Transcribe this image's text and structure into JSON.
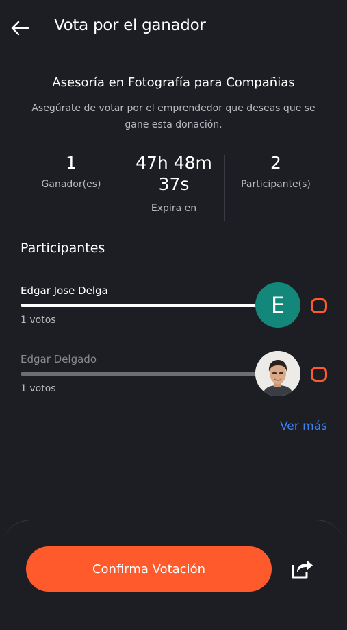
{
  "header": {
    "title": "Vota por el ganador",
    "back_icon": "arrow-left-icon"
  },
  "intro": {
    "heading": "Asesoría en Fotografía para Compañias",
    "description": "Asegúrate de votar por el emprendedor que deseas que se gane esta donación."
  },
  "stats": {
    "winners": {
      "value": "1",
      "label": "Ganador(es)"
    },
    "timer": {
      "value_line1": "47h 48m",
      "value_line2": "37s",
      "label": "Expira en"
    },
    "participants": {
      "value": "2",
      "label": "Participante(s)"
    }
  },
  "participants_section": {
    "title": "Participantes",
    "items": [
      {
        "name": "Edgar Jose Delga",
        "votes": "1 votos",
        "avatar_letter": "E",
        "avatar_color": "#12877a",
        "bar_fraction": 1.0,
        "active": true
      },
      {
        "name": "Edgar Delgado",
        "votes": "1 votos",
        "avatar_type": "photo",
        "bar_fraction": 1.0,
        "active": false
      }
    ],
    "ver_mas": "Ver más"
  },
  "footer": {
    "confirm_label": "Confirma Votación",
    "share_icon": "share-icon"
  },
  "colors": {
    "background": "#1d1e24",
    "accent": "#ff5a2c",
    "link": "#3b82f6"
  }
}
